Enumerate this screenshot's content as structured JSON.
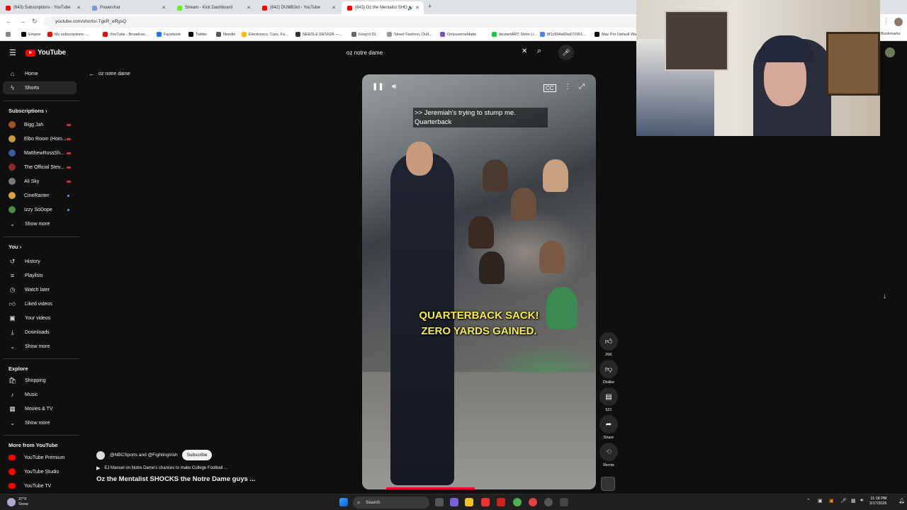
{
  "browser": {
    "tabs": [
      {
        "label": "(643) Subscriptions - YouTube",
        "color": "#ff0000"
      },
      {
        "label": "Powerchat",
        "color": "#7a9ccf"
      },
      {
        "label": "Stream - Kick Dashboard",
        "color": "#53fc18"
      },
      {
        "label": "(642) DUMB3rd - YouTube",
        "color": "#ff0000"
      },
      {
        "label": "(643) Oz the Mentalist SHO",
        "color": "#ff0000"
      }
    ],
    "url": "youtube.com/shorts/-TgkR_eRgsQ",
    "bookmarks": [
      "Empire",
      "My subscriptions -...",
      "YouTube - Broadcas...",
      "Facebook",
      "Twitter",
      "Needle",
      "Electronics, Cars, Fa...",
      "NEEDLE DESIGN —...",
      "Keep'd DL",
      "Street Fashion, Outl...",
      "Onlyusemeblade",
      "deviantART: More Li...",
      "8f1c994a69a971961...",
      "Mac Pro Default Wa...",
      "Bookmarks"
    ]
  },
  "header": {
    "logo_text": "YouTube",
    "search_value": "oz notre dame"
  },
  "sidebar": {
    "main": [
      {
        "label": "Home",
        "icon": "home-icon"
      },
      {
        "label": "Shorts",
        "icon": "shorts-icon"
      }
    ],
    "subscriptions_title": "Subscriptions",
    "subscriptions": [
      {
        "label": "Bigg Jah",
        "color": "#a0522d",
        "status": "live"
      },
      {
        "label": "Elbo Room (Hom...",
        "color": "#c99a3c",
        "status": "live"
      },
      {
        "label": "MatthewRossSh...",
        "color": "#3d5a99",
        "status": "live"
      },
      {
        "label": "The Official Stev...",
        "color": "#8b2b2b",
        "status": "live"
      },
      {
        "label": "Ali Sky",
        "color": "#777777",
        "status": "live"
      },
      {
        "label": "CineRanter",
        "color": "#e0a040",
        "status": "new"
      },
      {
        "label": "Izzy SoDope",
        "color": "#4c8a4c",
        "status": "new"
      }
    ],
    "show_more": "Show more",
    "you_title": "You",
    "you": [
      {
        "label": "History",
        "icon": "history-icon"
      },
      {
        "label": "Playlists",
        "icon": "playlists-icon"
      },
      {
        "label": "Watch later",
        "icon": "watch-later-icon"
      },
      {
        "label": "Liked videos",
        "icon": "liked-icon"
      },
      {
        "label": "Your videos",
        "icon": "your-videos-icon"
      },
      {
        "label": "Downloads",
        "icon": "downloads-icon"
      }
    ],
    "explore_title": "Explore",
    "explore": [
      {
        "label": "Shopping",
        "icon": "shopping-icon"
      },
      {
        "label": "Music",
        "icon": "music-icon"
      },
      {
        "label": "Movies & TV",
        "icon": "movies-icon"
      }
    ],
    "more_title": "More from YouTube",
    "more": [
      {
        "label": "YouTube Premium"
      },
      {
        "label": "YouTube Studio"
      },
      {
        "label": "YouTube TV"
      }
    ]
  },
  "back_label": "oz notre dame",
  "video": {
    "caption_top_1": ">> Jeremiah's trying to stump me.",
    "caption_top_2": "Quarterback",
    "caption_mid_1": "QUARTERBACK SACK!",
    "caption_mid_2": "ZERO YARDS GAINED.",
    "progress_fraction": 0.38
  },
  "actions": {
    "like_count": "26K",
    "dislike_label": "Dislike",
    "comment_count": "521",
    "share_label": "Share",
    "remix_label": "Remix"
  },
  "info": {
    "channels": "@NBCSports and @FightingIrish",
    "subscribe": "Subscribe",
    "related": "EJ Manuel on Notre Dame's chances to make College Football ...",
    "title": "Oz the Mentalist SHOCKS the Notre Dame guys ..."
  },
  "taskbar": {
    "weather_temp": "37°F",
    "weather_desc": "Snow",
    "search_label": "Search",
    "time": "11:18 PM",
    "date": "2/17/2026"
  }
}
